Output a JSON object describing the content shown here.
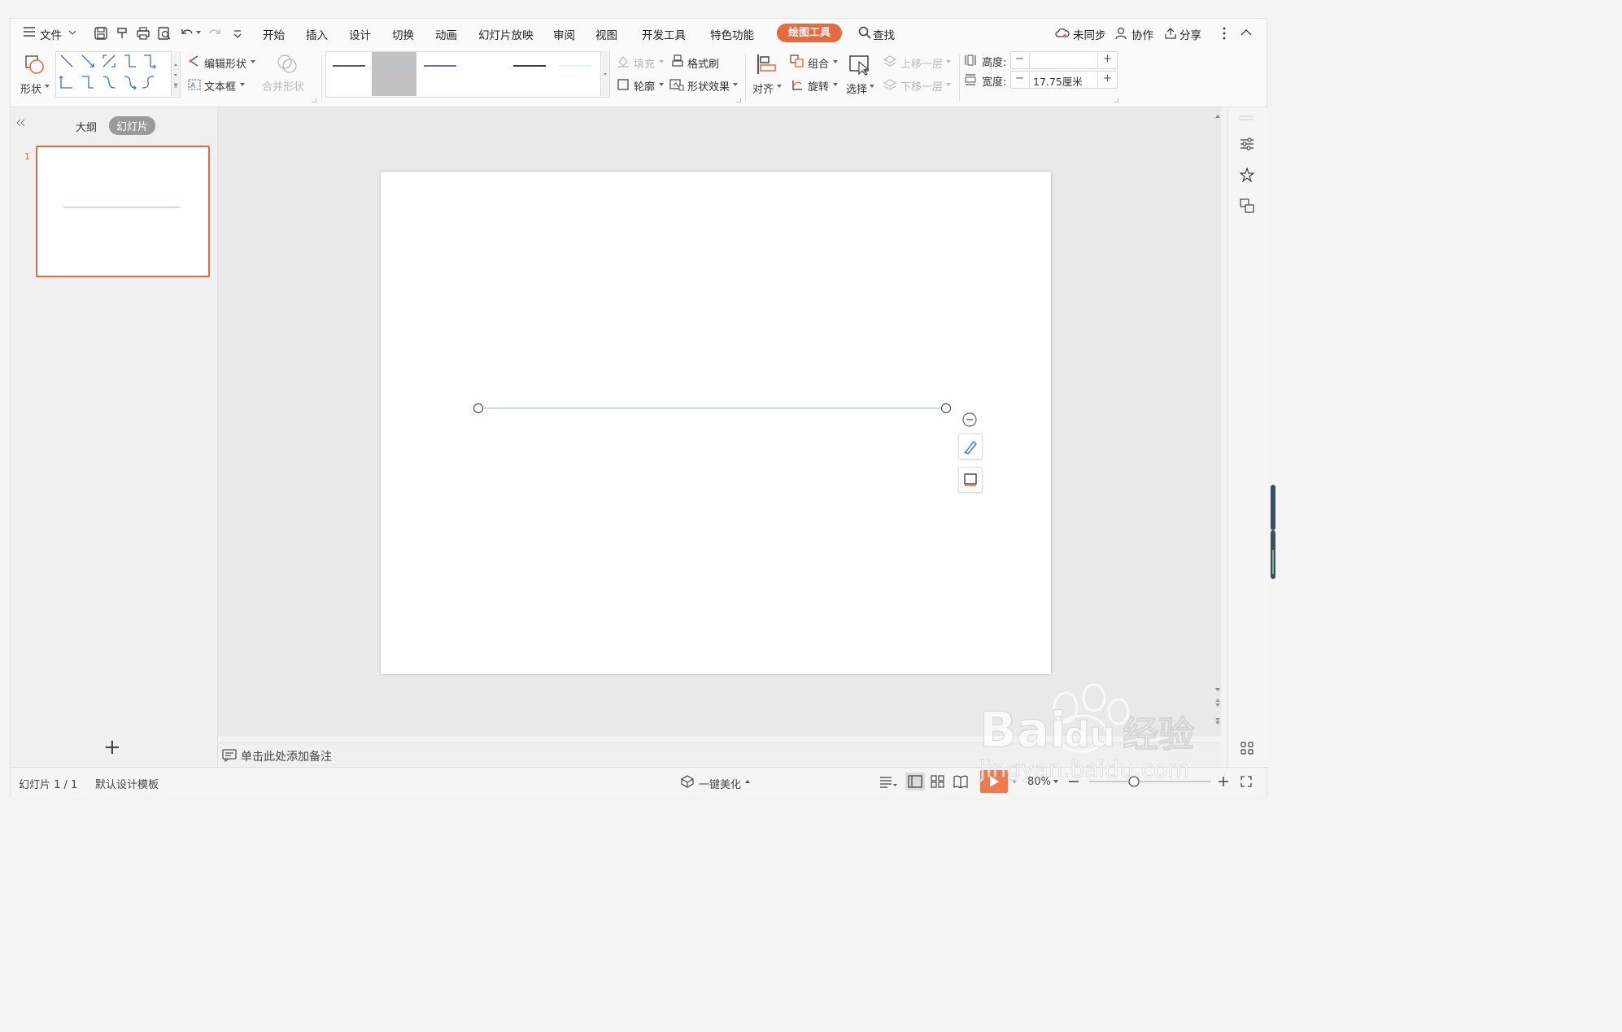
{
  "menubar": {
    "file_label": "文件",
    "tabs": [
      "开始",
      "插入",
      "设计",
      "切换",
      "动画",
      "幻灯片放映",
      "审阅",
      "视图",
      "开发工具",
      "特色功能"
    ],
    "active_tab": "绘图工具",
    "search_label": "查找",
    "sync_label": "未同步",
    "collab_label": "协作",
    "share_label": "分享"
  },
  "ribbon": {
    "shape_label": "形状",
    "edit_shape_label": "编辑形状",
    "textbox_label": "文本框",
    "merge_shape_label": "合并形状",
    "fill_label": "填充",
    "format_painter_label": "格式刷",
    "outline_label": "轮廓",
    "shape_effect_label": "形状效果",
    "align_label": "对齐",
    "group_label": "组合",
    "rotate_label": "旋转",
    "select_label": "选择",
    "bring_forward_label": "上移一层",
    "send_backward_label": "下移一层",
    "height_label": "高度:",
    "height_value": "",
    "width_label": "宽度:",
    "width_value": "17.75厘米",
    "minus": "−",
    "plus": "+"
  },
  "leftpanel": {
    "outline_tab": "大纲",
    "slides_tab": "幻灯片",
    "slide_number": "1",
    "add_label": "+"
  },
  "notes": {
    "placeholder": "单击此处添加备注"
  },
  "statusbar": {
    "slide_info": "幻灯片 1 / 1",
    "template": "默认设计模板",
    "beautify_label": "一键美化",
    "zoom": "80%"
  },
  "colors": {
    "accent": "#e8683f",
    "line": "#a9c8d8",
    "thumb_border": "#e8683f"
  },
  "watermark": "Baidu经验 jingyan.baidu.com"
}
